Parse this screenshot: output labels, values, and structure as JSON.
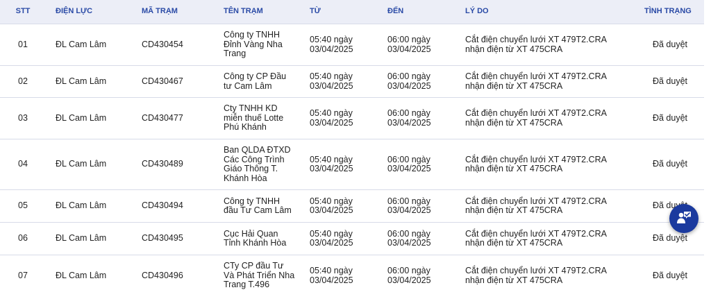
{
  "table": {
    "headers": [
      "STT",
      "ĐIỆN LỰC",
      "MÃ TRẠM",
      "TÊN TRẠM",
      "TỪ",
      "ĐẾN",
      "LÝ DO",
      "TÌNH TRẠNG"
    ],
    "rows": [
      {
        "stt": "01",
        "dien_luc": "ĐL Cam Lâm",
        "ma_tram": "CD430454",
        "ten_tram": "Công ty TNHH Đỉnh Vàng Nha Trang",
        "tu": "05:40 ngày 03/04/2025",
        "den": "06:00 ngày 03/04/2025",
        "ly_do": "Cắt điện chuyển lưới XT 479T2.CRA nhận điện từ XT 475CRA",
        "tinh_trang": "Đã duyệt"
      },
      {
        "stt": "02",
        "dien_luc": "ĐL Cam Lâm",
        "ma_tram": "CD430467",
        "ten_tram": "Công ty CP Đầu tư Cam Lâm",
        "tu": "05:40 ngày 03/04/2025",
        "den": "06:00 ngày 03/04/2025",
        "ly_do": "Cắt điện chuyển lưới XT 479T2.CRA nhận điện từ XT 475CRA",
        "tinh_trang": "Đã duyệt"
      },
      {
        "stt": "03",
        "dien_luc": "ĐL Cam Lâm",
        "ma_tram": "CD430477",
        "ten_tram": "Cty TNHH KD miễn thuế Lotte Phú Khánh",
        "tu": "05:40 ngày 03/04/2025",
        "den": "06:00 ngày 03/04/2025",
        "ly_do": "Cắt điện chuyển lưới XT 479T2.CRA nhận điện từ XT 475CRA",
        "tinh_trang": "Đã duyệt"
      },
      {
        "stt": "04",
        "dien_luc": "ĐL Cam Lâm",
        "ma_tram": "CD430489",
        "ten_tram": "Ban QLDA ĐTXD Các Công Trình Giáo Thông T. Khánh Hòa",
        "tu": "05:40 ngày 03/04/2025",
        "den": "06:00 ngày 03/04/2025",
        "ly_do": "Cắt điện chuyển lưới XT 479T2.CRA nhận điện từ XT 475CRA",
        "tinh_trang": "Đã duyệt"
      },
      {
        "stt": "05",
        "dien_luc": "ĐL Cam Lâm",
        "ma_tram": "CD430494",
        "ten_tram": "Công ty TNHH đầu Tư Cam Lâm",
        "tu": "05:40 ngày 03/04/2025",
        "den": "06:00 ngày 03/04/2025",
        "ly_do": "Cắt điện chuyển lưới XT 479T2.CRA nhận điện từ XT 475CRA",
        "tinh_trang": "Đã duyệt"
      },
      {
        "stt": "06",
        "dien_luc": "ĐL Cam Lâm",
        "ma_tram": "CD430495",
        "ten_tram": "Cục Hải Quan Tỉnh Khánh Hòa",
        "tu": "05:40 ngày 03/04/2025",
        "den": "06:00 ngày 03/04/2025",
        "ly_do": "Cắt điện chuyển lưới XT 479T2.CRA nhận điện từ XT 475CRA",
        "tinh_trang": "Đã duyệt"
      },
      {
        "stt": "07",
        "dien_luc": "ĐL Cam Lâm",
        "ma_tram": "CD430496",
        "ten_tram": "CTy CP đầu Tư Và Phát Triển Nha Trang T.496",
        "tu": "05:40 ngày 03/04/2025",
        "den": "06:00 ngày 03/04/2025",
        "ly_do": "Cắt điện chuyển lưới XT 479T2.CRA nhận điện từ XT 475CRA",
        "tinh_trang": "Đã duyệt"
      }
    ]
  },
  "fab": {
    "icon": "support-chat-icon"
  },
  "colors": {
    "header_bg": "#eceef7",
    "header_text": "#2a4aa6",
    "fab_bg": "#1b3a9e",
    "row_border": "#d7dbe8"
  }
}
